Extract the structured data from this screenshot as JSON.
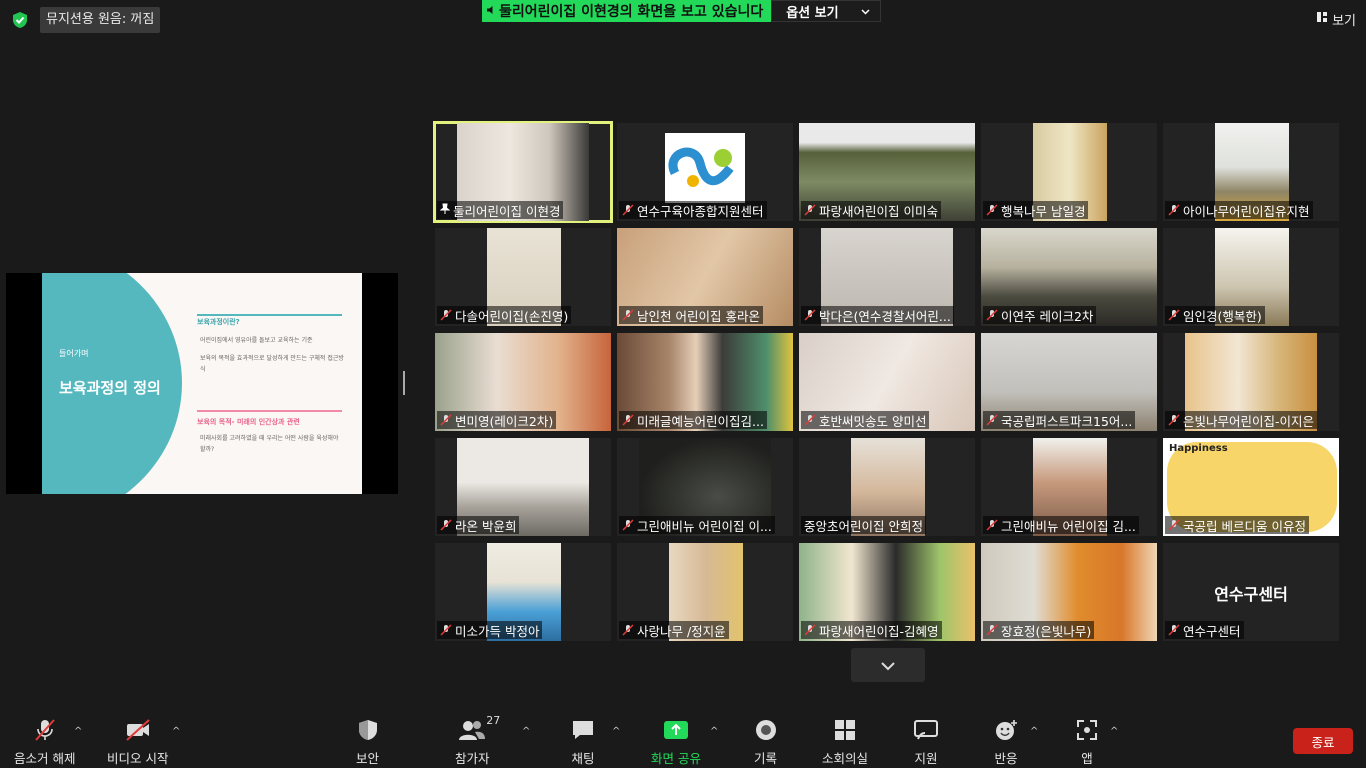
{
  "top": {
    "original_sound": "뮤지션용 원음: 꺼짐",
    "share_banner": "둘리어린이집 이현경의 화면을 보고 있습니다",
    "view_options": "옵션 보기",
    "view": "보기"
  },
  "slide": {
    "intro": "들어가며",
    "title": "보육과정의 정의",
    "q1": "보육과정이란?",
    "b1": "어린이집에서 영유아를 돌보고 교육하는 기준",
    "b2": "보육의 목적을 효과적으로 달성하게 만드는 구체적 접근방식",
    "q2": "보육의 목적- 미래의 인간상과 관련",
    "b3": "미래사회를 고려하였을 때 우리는 어떤 사람을 육성해야 할까?"
  },
  "participants": [
    "둘리어린이집 이현경",
    "연수구육아종합지원센터",
    "파랑새어린이집 이미숙",
    "행복나무 남일경",
    "아이나무어린이집유지현",
    "다솔어린이집(손진영)",
    "남인천 어린이집 홍라온",
    "박다은(연수경찰서어린...",
    "이연주 레이크2차",
    "임인경(행복한)",
    "변미영(레이크2차)",
    "미래글예능어린이집김...",
    "호반써밋송도 양미선",
    "국공립퍼스트파크15어...",
    "은빛나무어린이집-이지은",
    "라온 박윤희",
    "그린애비뉴 어린이집 이...",
    "중앙초어린이집 안희정",
    "그린애비뉴 어린이집 김...",
    "국공립 베르디움 이유정",
    "미소가득 박정아",
    "사랑나무 /정지윤",
    "파랑새어린이집-김혜영",
    "장효정(은빛나무)",
    "연수구센터"
  ],
  "no_video_tile_text": "연수구센터",
  "happiness_text": "Happiness",
  "toolbar": {
    "unmute": "음소거 해제",
    "start_video": "비디오 시작",
    "security": "보안",
    "participants": "참가자",
    "participant_count": "27",
    "chat": "채팅",
    "share_screen": "화면 공유",
    "record": "기록",
    "breakout": "소회의실",
    "support": "지원",
    "reactions": "반응",
    "apps": "앱",
    "end": "종료"
  },
  "colors": {
    "share_green": "#23d959",
    "active_speaker": "#e2f27c",
    "end_red": "#c9221b",
    "mute_red": "#e03a3a"
  }
}
